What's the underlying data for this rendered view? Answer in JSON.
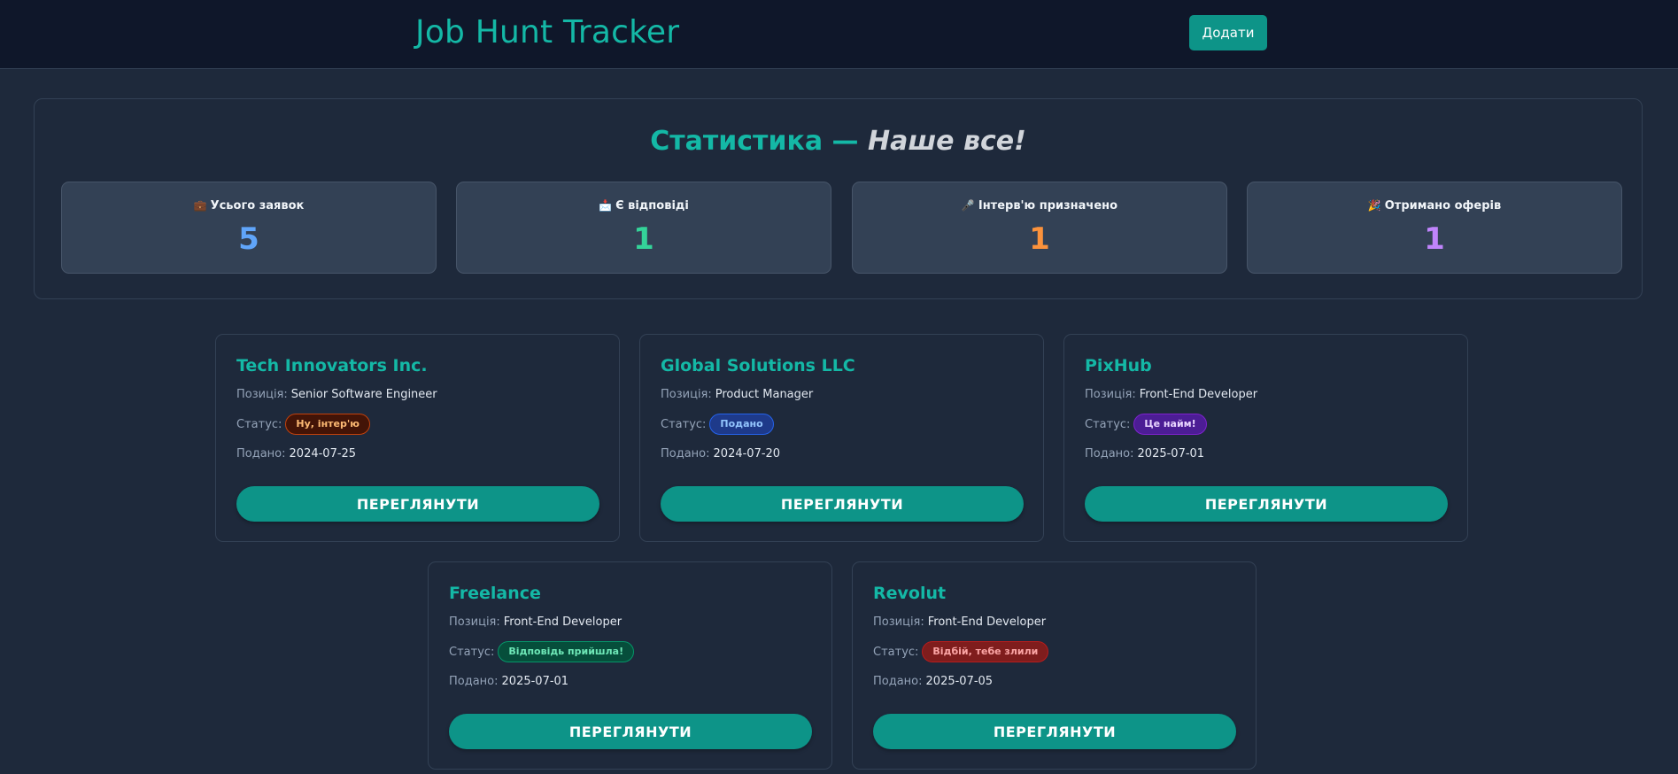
{
  "header": {
    "title": "Job Hunt Tracker",
    "add_label": "Додати"
  },
  "stats": {
    "title": "Статистика — ",
    "title_em": "Наше все!",
    "cards": [
      {
        "icon": "briefcase-icon",
        "glyph": "💼",
        "label": "Усього заявок",
        "value": "5",
        "color": "#60a5fa"
      },
      {
        "icon": "inbox-icon",
        "glyph": "📩",
        "label": "Є відповіді",
        "value": "1",
        "color": "#34d399"
      },
      {
        "icon": "microphone-icon",
        "glyph": "🎤",
        "label": "Інтерв'ю призначено",
        "value": "1",
        "color": "#fb923c"
      },
      {
        "icon": "party-popper-icon",
        "glyph": "🎉",
        "label": "Отримано оферів",
        "value": "1",
        "color": "#c084fc"
      }
    ]
  },
  "labels": {
    "position": "Позиція:",
    "status": "Статус:",
    "applied": "Подано:",
    "view": "ПЕРЕГЛЯНУТИ"
  },
  "jobs": [
    {
      "company": "Tech Innovators Inc.",
      "position": "Senior Software Engineer",
      "status": "Ну, інтер'ю",
      "status_color": "#fdba74",
      "status_bg": "#431407",
      "status_border": "#c2410c",
      "date": "2024-07-25"
    },
    {
      "company": "Global Solutions LLC",
      "position": "Product Manager",
      "status": "Подано",
      "status_color": "#93c5fd",
      "status_bg": "#1e3a8a",
      "status_border": "#2563eb",
      "date": "2024-07-20"
    },
    {
      "company": "PixHub",
      "position": "Front-End Developer",
      "status": "Це найм!",
      "status_color": "#e9d5ff",
      "status_bg": "#4c1d95",
      "status_border": "#7e22ce",
      "date": "2025-07-01"
    },
    {
      "company": "Freelance",
      "position": "Front-End Developer",
      "status": "Відповідь прийшла!",
      "status_color": "#6ee7b7",
      "status_bg": "#064e3b",
      "status_border": "#059669",
      "date": "2025-07-01"
    },
    {
      "company": "Revolut",
      "position": "Front-End Developer",
      "status": "Відбій, тебе злили",
      "status_color": "#fca5a5",
      "status_bg": "#7f1d1d",
      "status_border": "#b91c1c",
      "date": "2025-07-05"
    }
  ]
}
